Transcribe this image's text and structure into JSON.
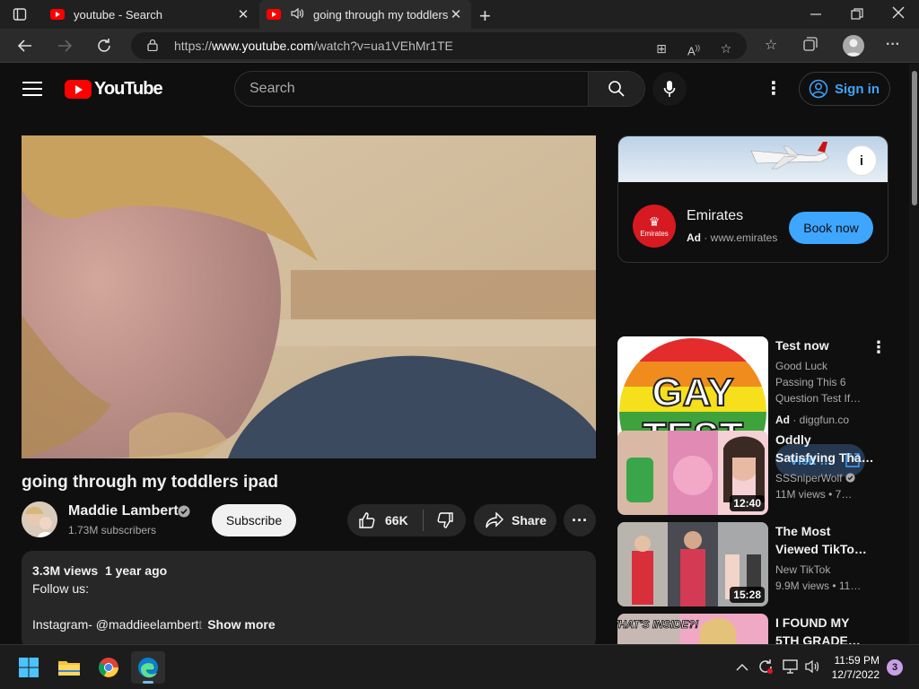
{
  "browser": {
    "tabs": [
      {
        "title": "youtube - Search",
        "active": false
      },
      {
        "title": "going through my toddlers",
        "active": true
      }
    ],
    "url_prefix": "https://",
    "url_host": "www.youtube.com",
    "url_path": "/watch?v=ua1VEhMr1TE"
  },
  "header": {
    "logo_text": "YouTube",
    "search_placeholder": "Search",
    "signin_label": "Sign in"
  },
  "video": {
    "title": "going through my toddlers ipad",
    "channel": "Maddie Lambert",
    "subscribers": "1.73M subscribers",
    "subscribe_label": "Subscribe",
    "likes": "66K",
    "share_label": "Share",
    "views": "3.3M views",
    "age": "1 year ago",
    "desc_line1": "Follow us:",
    "desc_line3": "Instagram- @maddieelambert",
    "desc_line3_fade": "t",
    "show_more": "Show more"
  },
  "sidebar": {
    "ad": {
      "name": "Emirates",
      "badge": "Ad",
      "domain": "· www.emirates",
      "logo_text": "Emirates",
      "cta": "Book now"
    },
    "promo": {
      "title": "Test now",
      "description": "Good Luck Passing This 6 Question Test If…",
      "badge": "Ad",
      "domain": "· diggfun.co",
      "cta": "Visit …",
      "thumb_line1": "GAY",
      "thumb_line2": "TEST"
    },
    "recommendations": [
      {
        "title": "Oddly Satisfying Tha…",
        "channel": "SSSniperWolf",
        "meta": "11M views  • 7…",
        "duration": "12:40"
      },
      {
        "title": "The Most Viewed TikTo…",
        "channel": "New TikTok",
        "meta": "9.9M views  • 11…",
        "duration": "15:28"
      },
      {
        "title": "I FOUND MY 5TH GRADE…",
        "thumb_text": "WHAT'S INSIDE?!"
      }
    ]
  },
  "taskbar": {
    "time": "11:59 PM",
    "date": "12/7/2022",
    "notifications": "3"
  }
}
